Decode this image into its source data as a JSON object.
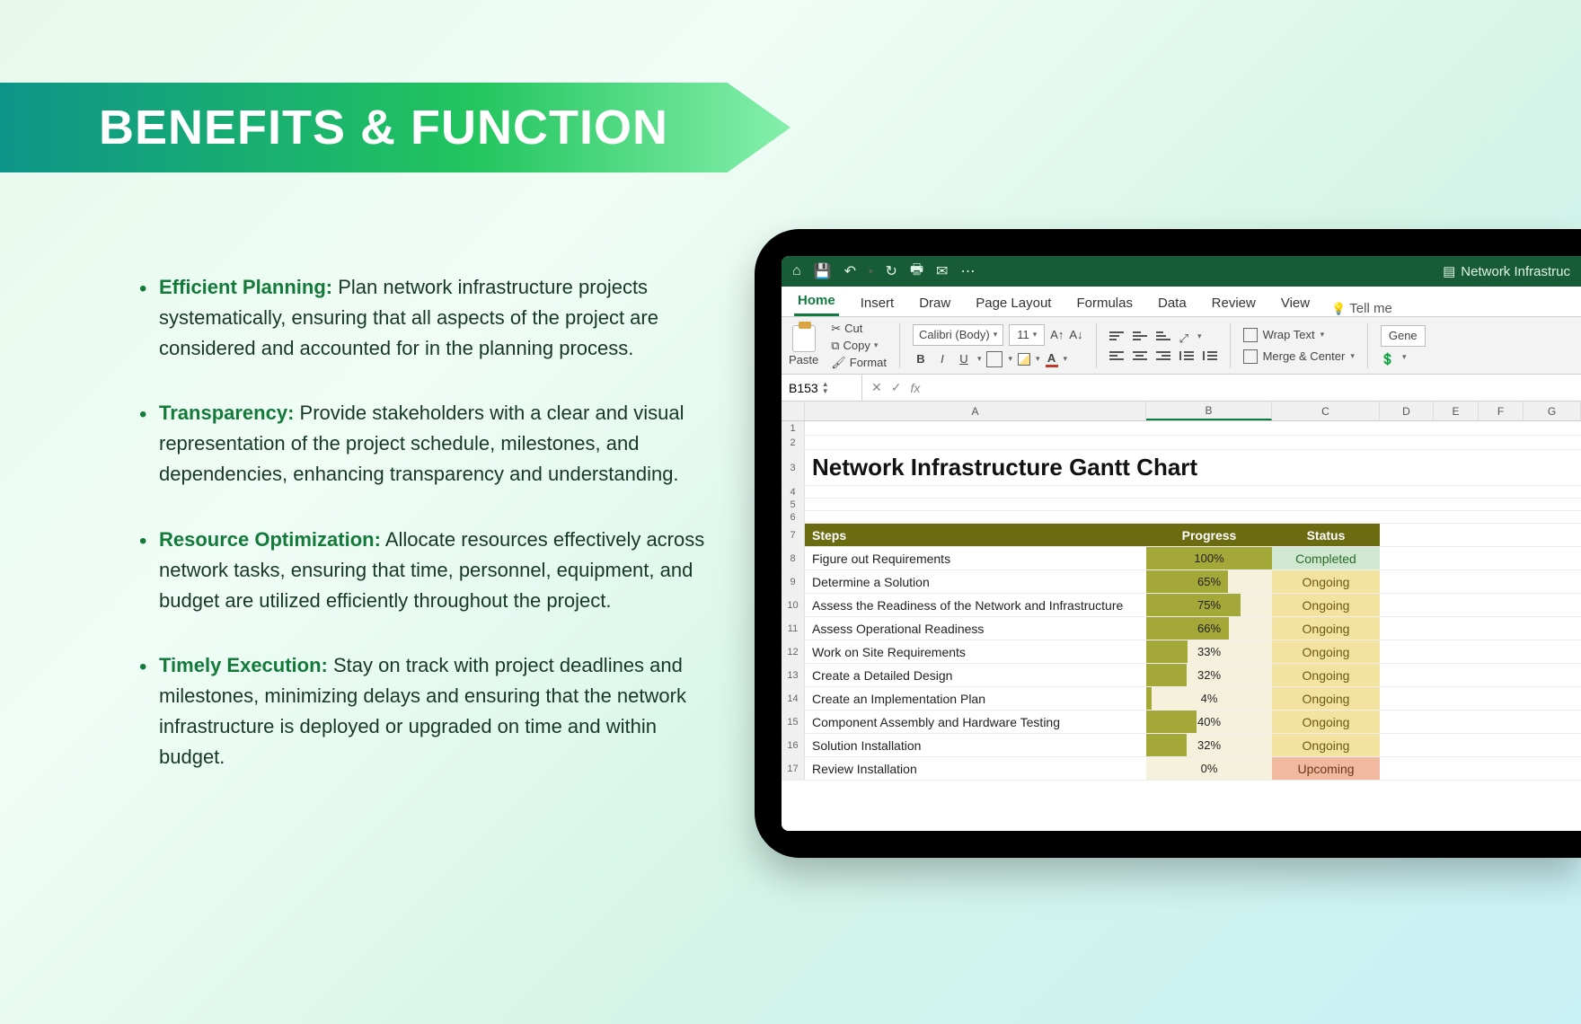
{
  "header": {
    "title": "BENEFITS & FUNCTION"
  },
  "bullets": [
    {
      "strong": "Efficient Planning:",
      "text": " Plan network infrastructure projects systematically, ensuring that all aspects of the project are considered and accounted for in the planning process."
    },
    {
      "strong": "Transparency:",
      "text": " Provide stakeholders with a clear and visual representation of the project schedule, milestones, and dependencies, enhancing transparency and understanding."
    },
    {
      "strong": "Resource Optimization:",
      "text": " Allocate resources effectively across network tasks, ensuring that time, personnel, equipment, and budget are utilized efficiently throughout the project."
    },
    {
      "strong": "Timely Execution:",
      "text": " Stay on track with project deadlines and milestones, minimizing delays and ensuring that the network infrastructure is deployed or upgraded on time and within budget."
    }
  ],
  "excel": {
    "filename": "Network Infrastruc",
    "tabs": [
      "Home",
      "Insert",
      "Draw",
      "Page Layout",
      "Formulas",
      "Data",
      "Review",
      "View"
    ],
    "tellme": "Tell me",
    "ribbon": {
      "paste": "Paste",
      "cut": "Cut",
      "copy": "Copy",
      "format": "Format",
      "font_name": "Calibri (Body)",
      "font_size": "11",
      "wrap": "Wrap Text",
      "merge": "Merge & Center",
      "general": "Gene"
    },
    "namebox": "B153",
    "cols": [
      "A",
      "B",
      "C",
      "D",
      "E",
      "F",
      "G"
    ],
    "sheet_title": "Network Infrastructure Gantt Chart",
    "table_headers": {
      "steps": "Steps",
      "progress": "Progress",
      "status": "Status"
    },
    "rows": [
      {
        "rn": "8",
        "step": "Figure out Requirements",
        "progress": 100,
        "progress_label": "100%",
        "status": "Completed",
        "status_class": "completed"
      },
      {
        "rn": "9",
        "step": "Determine a Solution",
        "progress": 65,
        "progress_label": "65%",
        "status": "Ongoing",
        "status_class": "ongoing"
      },
      {
        "rn": "10",
        "step": "Assess the Readiness of the Network and Infrastructure",
        "progress": 75,
        "progress_label": "75%",
        "status": "Ongoing",
        "status_class": "ongoing"
      },
      {
        "rn": "11",
        "step": "Assess Operational Readiness",
        "progress": 66,
        "progress_label": "66%",
        "status": "Ongoing",
        "status_class": "ongoing"
      },
      {
        "rn": "12",
        "step": "Work on Site Requirements",
        "progress": 33,
        "progress_label": "33%",
        "status": "Ongoing",
        "status_class": "ongoing"
      },
      {
        "rn": "13",
        "step": "Create a Detailed Design",
        "progress": 32,
        "progress_label": "32%",
        "status": "Ongoing",
        "status_class": "ongoing"
      },
      {
        "rn": "14",
        "step": "Create an Implementation Plan",
        "progress": 4,
        "progress_label": "4%",
        "status": "Ongoing",
        "status_class": "ongoing"
      },
      {
        "rn": "15",
        "step": "Component Assembly and Hardware Testing",
        "progress": 40,
        "progress_label": "40%",
        "status": "Ongoing",
        "status_class": "ongoing"
      },
      {
        "rn": "16",
        "step": "Solution Installation",
        "progress": 32,
        "progress_label": "32%",
        "status": "Ongoing",
        "status_class": "ongoing"
      },
      {
        "rn": "17",
        "step": "Review Installation",
        "progress": 0,
        "progress_label": "0%",
        "status": "Upcoming",
        "status_class": "upcoming"
      }
    ]
  },
  "chart_data": {
    "type": "bar",
    "title": "Network Infrastructure Gantt Chart",
    "xlabel": "Progress",
    "ylabel": "Steps",
    "categories": [
      "Figure out Requirements",
      "Determine a Solution",
      "Assess the Readiness of the Network and Infrastructure",
      "Assess Operational Readiness",
      "Work on Site Requirements",
      "Create a Detailed Design",
      "Create an Implementation Plan",
      "Component Assembly and Hardware Testing",
      "Solution Installation",
      "Review Installation"
    ],
    "values": [
      100,
      65,
      75,
      66,
      33,
      32,
      4,
      40,
      32,
      0
    ],
    "xlim": [
      0,
      100
    ],
    "annotations": {
      "status": [
        "Completed",
        "Ongoing",
        "Ongoing",
        "Ongoing",
        "Ongoing",
        "Ongoing",
        "Ongoing",
        "Ongoing",
        "Ongoing",
        "Upcoming"
      ]
    }
  }
}
